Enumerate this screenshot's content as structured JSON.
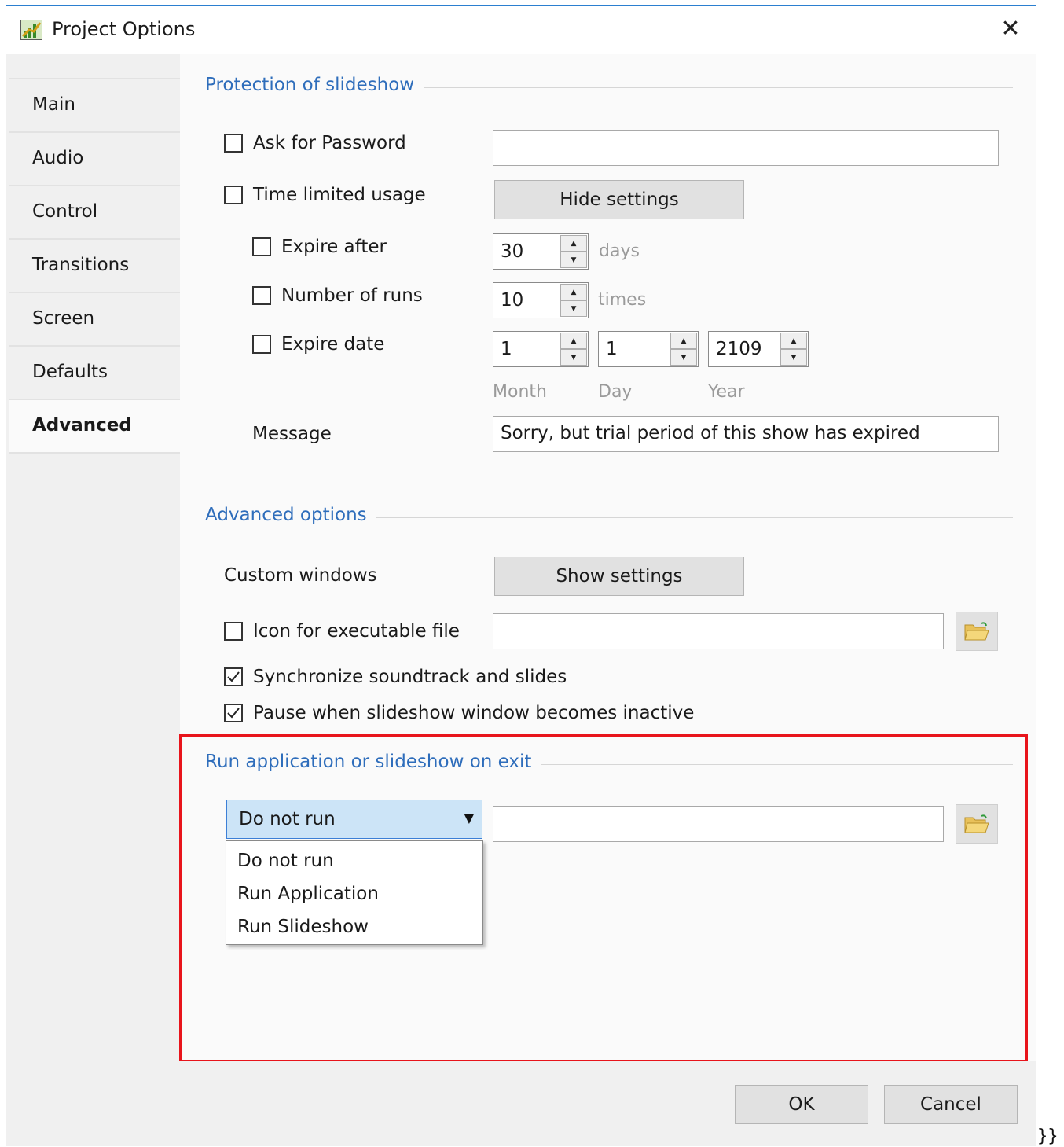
{
  "window": {
    "title": "Project Options",
    "close_symbol": "✕",
    "icon": "chart-icon"
  },
  "sidebar": {
    "tabs": [
      {
        "label": "Main"
      },
      {
        "label": "Audio"
      },
      {
        "label": "Control"
      },
      {
        "label": "Transitions"
      },
      {
        "label": "Screen"
      },
      {
        "label": "Defaults"
      },
      {
        "label": "Advanced",
        "active": true
      }
    ]
  },
  "protection": {
    "title": "Protection of slideshow",
    "ask_password": {
      "label": "Ask for Password",
      "checked": false,
      "value": ""
    },
    "time_limited": {
      "label": "Time limited usage",
      "checked": false
    },
    "hide_settings_label": "Hide settings",
    "expire_after": {
      "label": "Expire after",
      "checked": false,
      "value": "30",
      "unit": "days"
    },
    "number_of_runs": {
      "label": "Number of runs",
      "checked": false,
      "value": "10",
      "unit": "times"
    },
    "expire_date": {
      "label": "Expire date",
      "checked": false,
      "month": "1",
      "day": "1",
      "year": "2109"
    },
    "date_labels": {
      "month": "Month",
      "day": "Day",
      "year": "Year"
    },
    "message": {
      "label": "Message",
      "value": "Sorry, but trial period of this show has expired"
    }
  },
  "advanced": {
    "title": "Advanced options",
    "custom_windows_label": "Custom windows",
    "show_settings_label": "Show settings",
    "icon_exe": {
      "label": "Icon for executable file",
      "checked": false,
      "value": ""
    },
    "sync": {
      "label": "Synchronize soundtrack and slides",
      "checked": true
    },
    "pause": {
      "label": "Pause when slideshow window becomes inactive",
      "checked": true
    }
  },
  "run_on_exit": {
    "title": "Run application or slideshow on exit",
    "selected": "Do not run",
    "options": [
      "Do not run",
      "Run Application",
      "Run Slideshow"
    ],
    "path_value": ""
  },
  "footer": {
    "ok_label": "OK",
    "cancel_label": "Cancel"
  },
  "stray_text": "}}",
  "colors": {
    "accent": "#2e6dbb",
    "highlight_border": "#e8141b",
    "combo_bg": "#cce4f7"
  }
}
